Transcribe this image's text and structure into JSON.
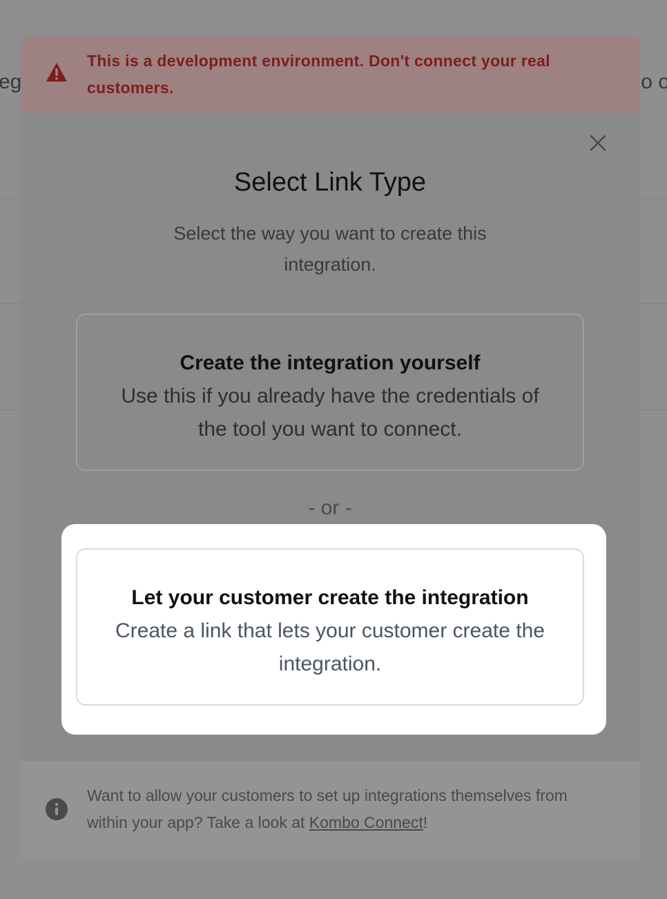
{
  "background": {
    "fragment_left": "eg",
    "fragment_right": "o o"
  },
  "banner": {
    "icon": "warning-triangle-icon",
    "text": "This is a development environment. Don't connect your real customers.",
    "color": "#7f1d1d"
  },
  "modal": {
    "close_icon": "close-icon",
    "title": "Select Link Type",
    "subtitle": "Select the way you want to create this integration.",
    "option_1": {
      "title": "Create the integration yourself",
      "description": "Use this if you already have the credentials of the tool you want to connect."
    },
    "divider": "- or -",
    "option_2": {
      "title": "Let your customer create the integration",
      "description": "Create a link that lets your customer create the integration."
    }
  },
  "footer": {
    "icon": "info-icon",
    "text_before": "Want to allow your customers to set up integrations themselves from within your app? Take a look at ",
    "link_label": "Kombo Connect",
    "text_after": "!"
  }
}
